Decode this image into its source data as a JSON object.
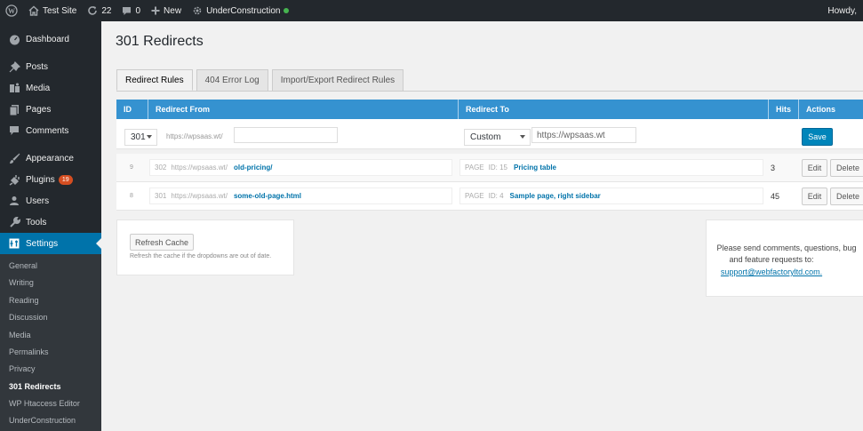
{
  "adminbar": {
    "site_name": "Test Site",
    "updates": "22",
    "comments": "0",
    "new_label": "New",
    "plugin_label": "UnderConstruction",
    "howdy": "Howdy,"
  },
  "sidebar": {
    "items": [
      {
        "label": "Dashboard",
        "icon": "dashboard-icon"
      },
      {
        "label": "Posts",
        "icon": "pin-icon"
      },
      {
        "label": "Media",
        "icon": "media-icon"
      },
      {
        "label": "Pages",
        "icon": "pages-icon"
      },
      {
        "label": "Comments",
        "icon": "comment-icon"
      },
      {
        "label": "Appearance",
        "icon": "brush-icon"
      },
      {
        "label": "Plugins",
        "icon": "plug-icon",
        "badge": "19"
      },
      {
        "label": "Users",
        "icon": "user-icon"
      },
      {
        "label": "Tools",
        "icon": "wrench-icon"
      },
      {
        "label": "Settings",
        "icon": "settings-icon"
      }
    ],
    "submenu": [
      "General",
      "Writing",
      "Reading",
      "Discussion",
      "Media",
      "Permalinks",
      "Privacy",
      "301 Redirects",
      "WP Htaccess Editor",
      "UnderConstruction"
    ]
  },
  "page": {
    "title": "301 Redirects",
    "tabs": [
      "Redirect Rules",
      "404 Error Log",
      "Import/Export Redirect Rules"
    ]
  },
  "table": {
    "headers": {
      "id": "ID",
      "from": "Redirect From",
      "to": "Redirect To",
      "hits": "Hits",
      "actions": "Actions"
    },
    "new_rule": {
      "status": "301",
      "prefix": "https://wpsaas.wt/",
      "from_value": "",
      "to_type": "Custom",
      "to_value": "https://wpsaas.wt",
      "save_label": "Save"
    },
    "rows": [
      {
        "id": "9",
        "status": "302",
        "prefix": "https://wpsaas.wt/",
        "path": "old-pricing/",
        "to_type": "PAGE",
        "to_id": "ID: 15",
        "to_title": "Pricing table",
        "hits": "3",
        "edit": "Edit",
        "delete": "Delete"
      },
      {
        "id": "8",
        "status": "301",
        "prefix": "https://wpsaas.wt/",
        "path": "some-old-page.html",
        "to_type": "PAGE",
        "to_id": "ID: 4",
        "to_title": "Sample page, right sidebar",
        "hits": "45",
        "edit": "Edit",
        "delete": "Delete"
      }
    ]
  },
  "cache": {
    "button": "Refresh Cache",
    "note": "Refresh the cache if the dropdowns are out of date."
  },
  "support": {
    "line1": "Please send comments, questions, bug",
    "line2": "and feature requests to:",
    "email": "support@webfactoryltd.com."
  },
  "colors": {
    "accent": "#0073aa",
    "header": "#3592d0",
    "adminbar": "#23282d"
  }
}
